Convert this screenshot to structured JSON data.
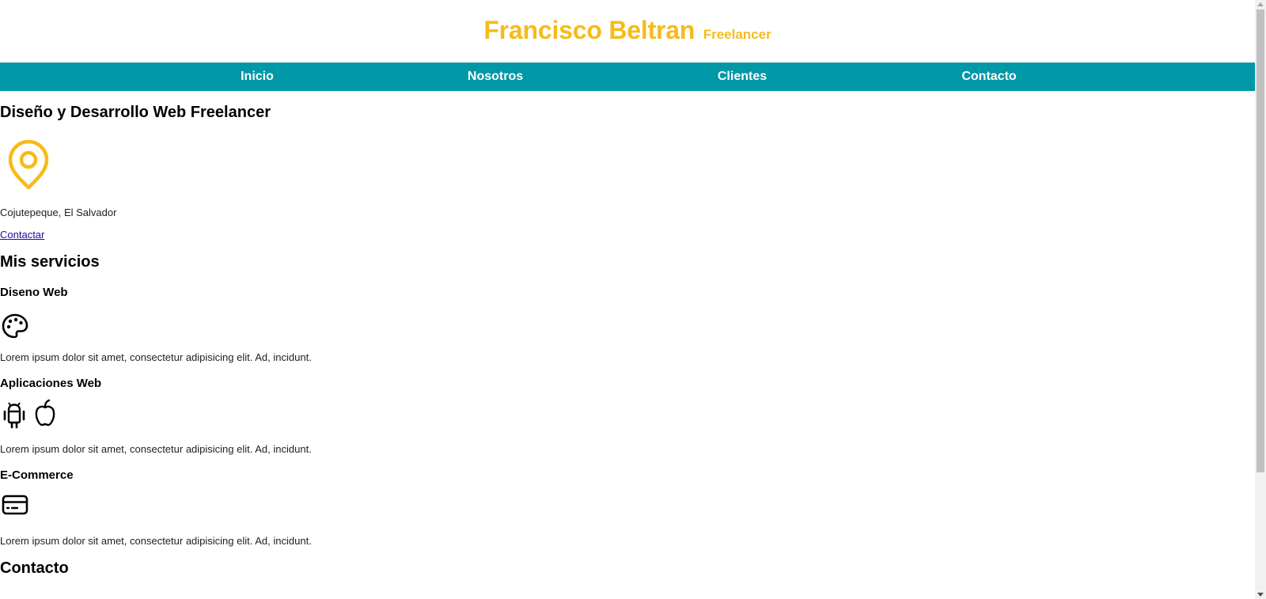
{
  "header": {
    "name": "Francisco Beltran",
    "subtitle": "Freelancer"
  },
  "nav": {
    "items": [
      "Inicio",
      "Nosotros",
      "Clientes",
      "Contacto"
    ]
  },
  "hero": {
    "title": "Diseño y Desarrollo Web Freelancer",
    "location_icon": "map-pin-icon",
    "location": "Cojutepeque, El Salvador",
    "contact_link": "Contactar"
  },
  "services": {
    "title": "Mis servicios",
    "items": [
      {
        "title": "Diseno Web",
        "icons": [
          "palette-icon"
        ],
        "text": "Lorem ipsum dolor sit amet, consectetur adipisicing elit. Ad, incidunt."
      },
      {
        "title": "Aplicaciones Web",
        "icons": [
          "android-icon",
          "apple-icon"
        ],
        "text": "Lorem ipsum dolor sit amet, consectetur adipisicing elit. Ad, incidunt."
      },
      {
        "title": "E-Commerce",
        "icons": [
          "credit-card-icon"
        ],
        "text": "Lorem ipsum dolor sit amet, consectetur adipisicing elit. Ad, incidunt."
      }
    ]
  },
  "contact": {
    "title": "Contacto"
  },
  "colors": {
    "brand": "#f6bb1a",
    "nav_bg": "#0097a7",
    "nav_text": "#ffffff"
  }
}
